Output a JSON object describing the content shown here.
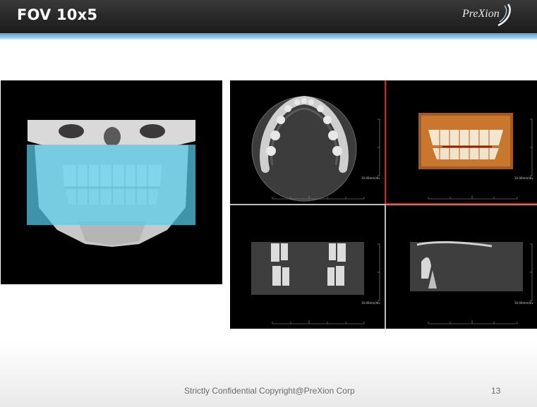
{
  "slide": {
    "title": "FOV 10x5",
    "logo_text": "PreXion",
    "footer_text": "Strictly Confidential Copyright@PreXion Corp",
    "page_number": "13"
  },
  "viewports": {
    "axial": {
      "scale_label": "10.00mm/div"
    },
    "render3d": {
      "scale_label": "10.00mm/div"
    },
    "coronal": {
      "scale_label": "10.00mm/div"
    },
    "sagittal": {
      "scale_label": "10.00mm/div"
    }
  },
  "colors": {
    "header_dark": "#2a2a2a",
    "header_accent": "#5a9fd4",
    "fov_overlay": "#57cdeb",
    "active_viewport_border": "#e02020"
  }
}
